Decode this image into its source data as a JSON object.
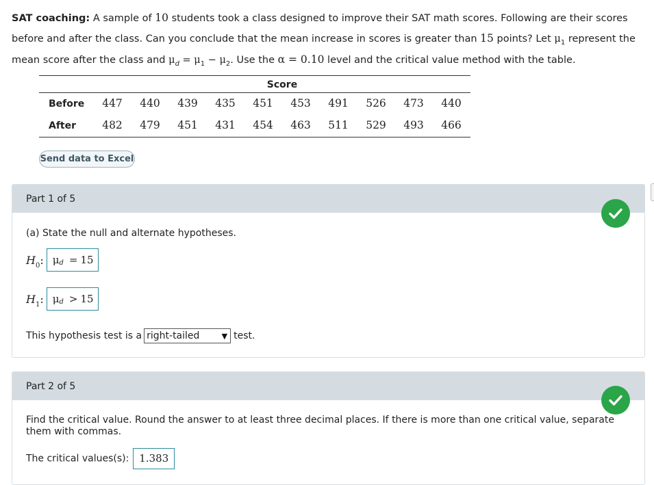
{
  "problem": {
    "title": "SAT coaching:",
    "text_1": " A sample of ",
    "n": "10",
    "text_2": " students took a class designed to improve their SAT math scores. Following are their scores before and after the class. Can you conclude that the mean increase in scores is greater than ",
    "threshold": "15",
    "text_3": " points? Let ",
    "mu": "μ",
    "one": "1",
    "text_4": " represent the mean score after the class and ",
    "d": "d",
    "eq": " = ",
    "minus": " − ",
    "two": "2",
    "text_5": ". Use the ",
    "alpha": "α = 0.10",
    "text_6": " level and the critical value method with the table."
  },
  "table": {
    "header": "Score",
    "before_label": "Before",
    "after_label": "After",
    "before": [
      "447",
      "440",
      "439",
      "435",
      "451",
      "453",
      "491",
      "526",
      "473",
      "440"
    ],
    "after": [
      "482",
      "479",
      "451",
      "431",
      "454",
      "463",
      "511",
      "529",
      "493",
      "466"
    ]
  },
  "excel_button": "Send data to Excel",
  "part1": {
    "header": "Part 1 of 5",
    "question": "(a) State the null and alternate hypotheses.",
    "h0_label": "H",
    "h0_sub": "0",
    "h1_label": "H",
    "h1_sub": "1",
    "colon": ":",
    "h0_param": "μ",
    "h0_param_sub": "d",
    "h0_rel": "=",
    "h0_value": "15",
    "h1_param": "μ",
    "h1_param_sub": "d",
    "h1_rel": ">",
    "h1_value": "15",
    "test_prefix": "This hypothesis test is a",
    "test_type": "right-tailed",
    "test_suffix": "test."
  },
  "part2": {
    "header": "Part 2 of 5",
    "question": "Find the critical value. Round the answer to at least three decimal places. If there is more than one critical value, separate them with commas.",
    "cv_label": "The critical values(s):",
    "cv_value": "1.383"
  },
  "colors": {
    "panel_header_bg": "#d4dce1",
    "check_green": "#2aa548",
    "answer_border": "#2c8a9a"
  }
}
